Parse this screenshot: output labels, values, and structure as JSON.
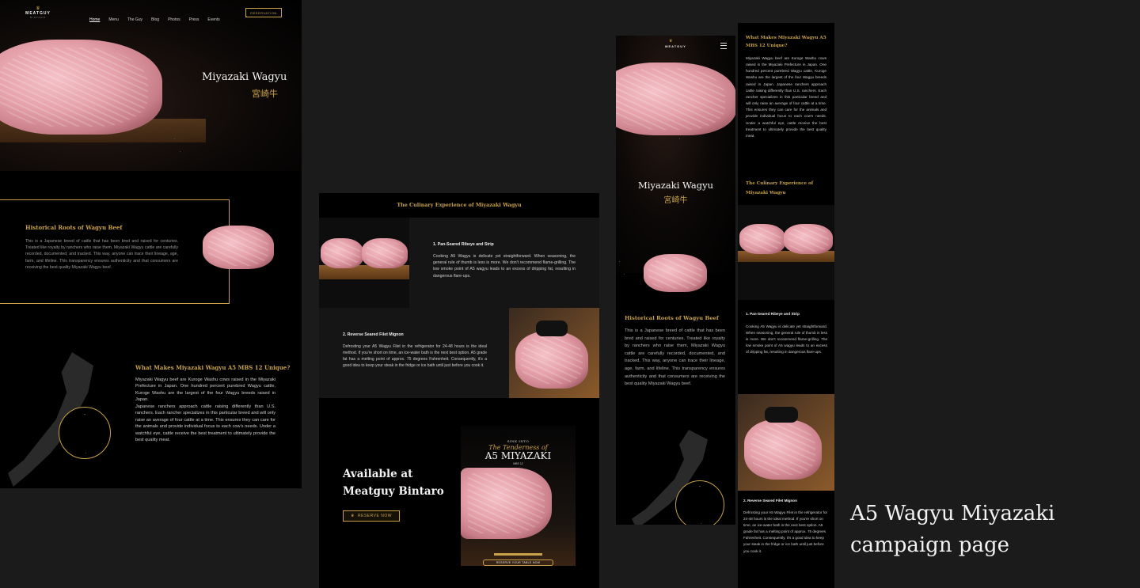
{
  "desktop": {
    "brand": "MEATGUY",
    "brand_sub": "BINTARO",
    "nav": [
      "Home",
      "Menu",
      "The Guy",
      "Blog",
      "Photos",
      "Press",
      "Events"
    ],
    "reservation": "RESERVATION",
    "hero_title": "Miyazaki Wagyu",
    "hero_kanji": "宮崎牛",
    "historical_title": "Historical Roots of Wagyu Beef",
    "historical_text": "This is a Japanese breed of cattle that has been bred and raised for centuries. Treated like royalty by ranchers who raise them, Miyazaki Wagyu cattle are carefully recorded, documented, and tracked. This way, anyone can trace their lineage, age, farm, and lifeline. This transparency ensures authenticity and that consumers are receiving the best quality Miyazaki Wagyu beef.",
    "unique_title": "What Makes Miyazaki Wagyu A5 MBS 12 Unique?",
    "unique_p1": "Miyazaki Wagyu beef are Kuroge Washu cows raised in the Miyazaki Prefecture in Japan. One hundred percent purebred Wagyu cattle, Kuroge Washu are the largest of the four Wagyu breeds raised in Japan.",
    "unique_p2": "Japanese ranchers approach cattle raising differently than U.S. ranchers. Each rancher specializes in this particular breed and will only raise an average of four cattle at a time. This ensures they can care for the animals and provide individual focus to each cow's needs. Under a watchful eye, cattle receive the best treatment to ultimately provide the best quality meat."
  },
  "culinary": {
    "title": "The Culinary Experience of Miyazaki Wagyu",
    "item1_title": "1. Pan-Seared Ribeye and Strip",
    "item1_text": "Cooking A5 Wagyu is delicate yet straightforward. When seasoning, the general rule of thumb is less is more. We don't recommend flame-grilling. The low smoke point of A5 wagyu leads to an excess of dripping fat, resulting in dangerous flare-ups.",
    "item2_title": "2. Reverse Seared Filet Mignon",
    "item2_text": "Defrosting your A5 Wagyu Filet in the refrigerator for 24-48 hours is the ideal method. If you're short on time, an ice-water bath is the next best option. A5 grade fat has a melting point of approx. 75 degrees Fahrenheit. Consequently, it's a good idea to keep your steak in the fridge or ice bath until just before you cook it.",
    "available_line1": "Available at",
    "available_line2": "Meatguy Bintaro",
    "reserve_now": "RESERVE NOW",
    "poster_sink": "SINK INTO",
    "poster_tender": "The Tenderness of",
    "poster_title": "A5 MIYAZAKI",
    "poster_mbs": "MBS 12",
    "poster_reserve": "RESERVE YOUR TABLE NOW"
  },
  "mobile": {
    "brand": "MEATGUY",
    "menu_icon": "hamburger-icon",
    "hero_title": "Miyazaki Wagyu",
    "hero_kanji": "宮崎牛",
    "historical_title": "Historical Roots of Wagyu Beef",
    "historical_text": "This is a Japanese breed of cattle that has been bred and raised for centuries. Treated like royalty by ranchers who raise them, Miyazaki Wagyu cattle are carefully recorded, documented, and tracked. This way, anyone can trace their lineage, age, farm, and lifeline. This transparency ensures authenticity and that consumers are receiving the best quality Miyazaki Wagyu beef."
  },
  "mobile2": {
    "unique_title": "What Makes Miyazaki Wagyu A5 MBS 12 Unique?",
    "unique_text": "Miyazaki Wagyu beef are Kuroge Washu cows raised in the Miyazaki Prefecture in Japan. One hundred percent purebred Wagyu cattle, Kuroge Washu are the largest of the four Wagyu breeds raised in Japan. Japanese ranchers approach cattle raising differently than U.S. ranchers. Each rancher specializes in this particular breed and will only raise an average of four cattle at a time. This ensures they can care for the animals and provide individual focus to each cow's needs. Under a watchful eye, cattle receive the best treatment to ultimately provide the best quality meat.",
    "culinary_title": "The Culinary Experience of Miyazaki Wagyu",
    "item1_title": "1. Pan-Seared Ribeye and Strip",
    "item1_text": "Cooking A5 Wagyu is delicate yet straightforward. When seasoning, the general rule of thumb is less is more. We don't recommend flame-grilling. The low smoke point of A5 wagyu leads to an excess of dripping fat, resulting in dangerous flare-ups.",
    "item2_title": "2. Reverse Seared Filet Mignon",
    "item2_text": "Defrosting your A5 Wagyu Filet in the refrigerator for 24-48 hours is the ideal method. If you're short on time, an ice-water bath is the next best option. A5 grade fat has a melting point of approx. 75 degrees Fahrenheit. Consequently, it's a good idea to keep your steak in the fridge or ice bath until just before you cook it."
  },
  "caption": {
    "line1": "A5 Wagyu Miyazaki",
    "line2": "campaign page"
  },
  "colors": {
    "gold": "#c9a24a",
    "background": "#1b1b1b",
    "panel": "#000000"
  }
}
